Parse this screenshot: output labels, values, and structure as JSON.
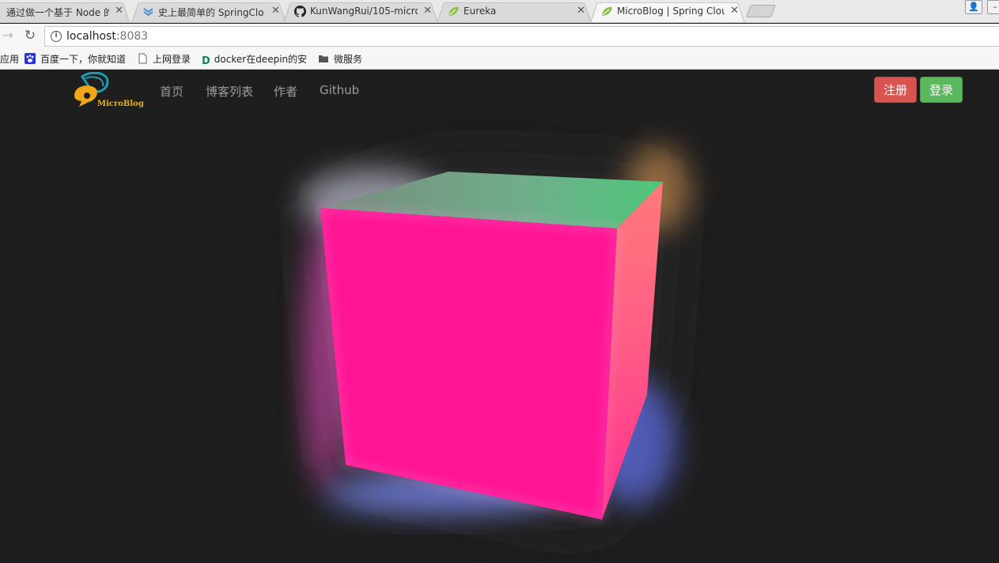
{
  "browser": {
    "tabs": [
      {
        "title": "通过做一个基于 Node 的",
        "favicon": "partial-icon"
      },
      {
        "title": "史上最简单的 SpringClo",
        "favicon": "blue-chevron-icon"
      },
      {
        "title": "KunWangRui/105-micro",
        "favicon": "github-icon"
      },
      {
        "title": "Eureka",
        "favicon": "spring-leaf-icon"
      },
      {
        "title": "MicroBlog | Spring Clou",
        "favicon": "spring-leaf-icon",
        "active": true
      }
    ],
    "address": {
      "host": "localhost",
      "port": ":8083"
    },
    "bookmarks": [
      {
        "label": "应用",
        "icon": "apps-icon"
      },
      {
        "label": "百度一下，你就知道",
        "icon": "baidu-paw-icon"
      },
      {
        "label": "上网登录",
        "icon": "page-icon"
      },
      {
        "label": "docker在deepin的安",
        "icon": "d-letter-icon"
      },
      {
        "label": "微服务",
        "icon": "folder-icon"
      }
    ]
  },
  "site": {
    "brand": "MicroBlog",
    "nav": [
      "首页",
      "博客列表",
      "作者",
      "Github"
    ],
    "register_label": "注册",
    "login_label": "登录"
  },
  "colors": {
    "page_bg": "#1e1e1e",
    "cube_front": "#ff1493",
    "register": "#d9534f",
    "login": "#5cb85c",
    "logo_leaf": "#1f9bb3",
    "logo_bubble": "#f0a818"
  }
}
